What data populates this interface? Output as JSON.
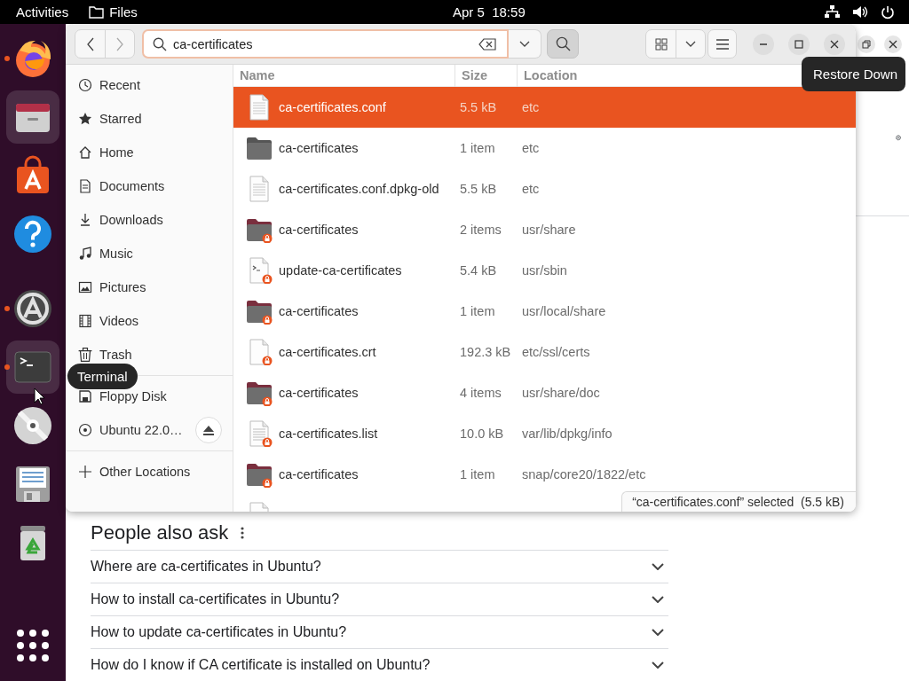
{
  "top_bar": {
    "activities": "Activities",
    "app_menu": "Files",
    "clock": "Apr 5  18:59"
  },
  "dock": {
    "items": [
      {
        "kind": "browser",
        "running": true,
        "highlighted": false
      },
      {
        "kind": "files",
        "running": false,
        "highlighted": true
      },
      {
        "kind": "store",
        "running": false,
        "highlighted": false
      },
      {
        "kind": "help",
        "running": false,
        "highlighted": false
      },
      {
        "kind": "updater",
        "running": true,
        "highlighted": false
      },
      {
        "kind": "terminal",
        "running": true,
        "highlighted": true,
        "tooltip": "Terminal"
      },
      {
        "kind": "disc",
        "running": false,
        "highlighted": false
      },
      {
        "kind": "floppy",
        "running": false,
        "highlighted": false
      },
      {
        "kind": "trash",
        "running": false,
        "highlighted": false
      },
      {
        "kind": "apps",
        "running": false,
        "highlighted": false
      }
    ]
  },
  "browser": {
    "restore_tooltip": "Restore Down",
    "people_also_ask": {
      "title": "People also ask",
      "questions": [
        {
          "text": "Where are ca-certificates in Ubuntu?",
          "expanded": false
        },
        {
          "text": "How to install ca-certificates in Ubuntu?",
          "expanded": false
        },
        {
          "text": "How to update ca-certificates in Ubuntu?",
          "expanded": false
        },
        {
          "text": "How do I know if CA certificate is installed on Ubuntu?",
          "expanded": false
        }
      ]
    }
  },
  "files_window": {
    "search": {
      "value": "ca-certificates"
    },
    "sidebar": {
      "places": [
        {
          "kind": "recent",
          "label": "Recent"
        },
        {
          "kind": "starred",
          "label": "Starred"
        },
        {
          "kind": "home",
          "label": "Home"
        },
        {
          "kind": "documents",
          "label": "Documents"
        },
        {
          "kind": "downloads",
          "label": "Downloads"
        },
        {
          "kind": "music",
          "label": "Music"
        },
        {
          "kind": "pictures",
          "label": "Pictures"
        },
        {
          "kind": "videos",
          "label": "Videos"
        },
        {
          "kind": "trash",
          "label": "Trash"
        }
      ],
      "devices": [
        {
          "kind": "floppy",
          "label": "Floppy Disk",
          "ejectable": false
        },
        {
          "kind": "optical",
          "label": "Ubuntu 22.0…",
          "ejectable": true
        }
      ],
      "other": [
        {
          "kind": "add",
          "label": "Other Locations"
        }
      ]
    },
    "columns": [
      "Name",
      "Size",
      "Location"
    ],
    "rows": [
      {
        "kind": "text",
        "locked": false,
        "name": "ca-certificates.conf",
        "size": "5.5 kB",
        "location": "etc",
        "selected": true
      },
      {
        "kind": "folder",
        "locked": false,
        "name": "ca-certificates",
        "size": "1 item",
        "location": "etc",
        "selected": false
      },
      {
        "kind": "text",
        "locked": false,
        "name": "ca-certificates.conf.dpkg-old",
        "size": "5.5 kB",
        "location": "etc",
        "selected": false
      },
      {
        "kind": "folder",
        "locked": true,
        "name": "ca-certificates",
        "size": "2 items",
        "location": "usr/share",
        "selected": false
      },
      {
        "kind": "script",
        "locked": true,
        "name": "update-ca-certificates",
        "size": "5.4 kB",
        "location": "usr/sbin",
        "selected": false
      },
      {
        "kind": "folder",
        "locked": true,
        "name": "ca-certificates",
        "size": "1 item",
        "location": "usr/local/share",
        "selected": false
      },
      {
        "kind": "file",
        "locked": true,
        "name": "ca-certificates.crt",
        "size": "192.3 kB",
        "location": "etc/ssl/certs",
        "selected": false
      },
      {
        "kind": "folder",
        "locked": true,
        "name": "ca-certificates",
        "size": "4 items",
        "location": "usr/share/doc",
        "selected": false
      },
      {
        "kind": "text",
        "locked": true,
        "name": "ca-certificates.list",
        "size": "10.0 kB",
        "location": "var/lib/dpkg/info",
        "selected": false
      },
      {
        "kind": "folder",
        "locked": true,
        "name": "ca-certificates",
        "size": "1 item",
        "location": "snap/core20/1822/etc",
        "selected": false
      },
      {
        "kind": "file",
        "selected": false
      }
    ],
    "status": "“ca-certificates.conf” selected  (5.5 kB)"
  }
}
